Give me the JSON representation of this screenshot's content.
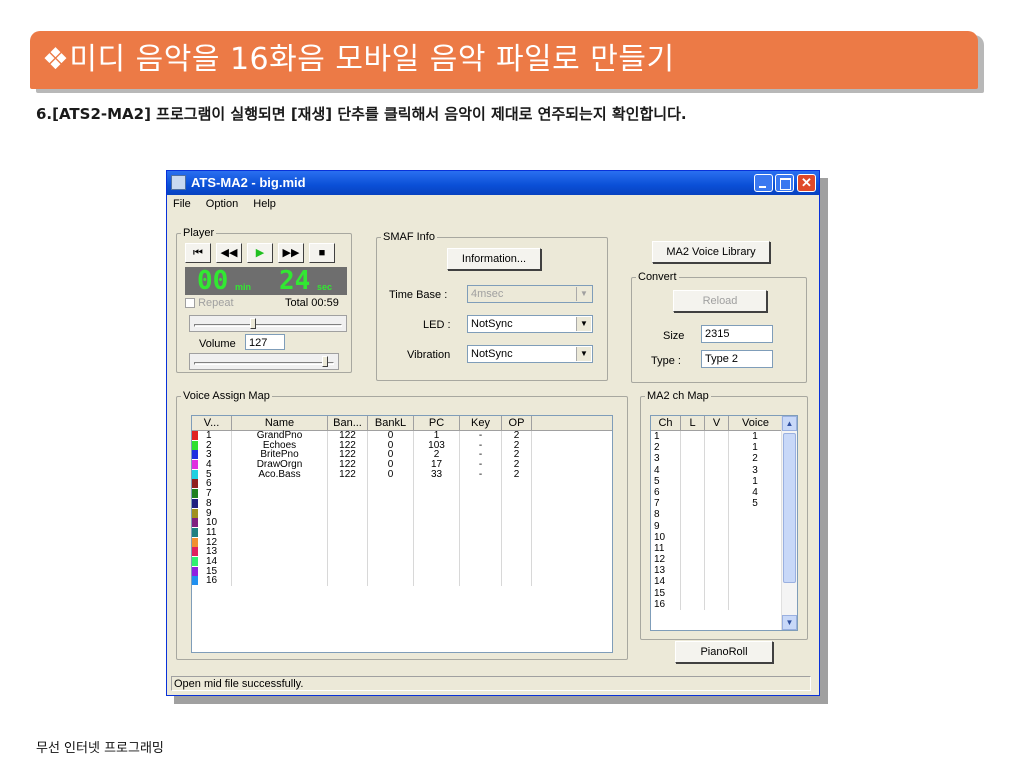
{
  "slide": {
    "title": "❖미디 음악을 16화음 모바일 음악 파일로 만들기",
    "subtitle": "6.[ATS2-MA2] 프로그램이 실행되면 [재생] 단추를 클릭해서 음악이 제대로 연주되는지 확인합니다.",
    "footer": "무선 인터넷 프로그래밍"
  },
  "window": {
    "title": "ATS-MA2 - big.mid",
    "close_glyph": "✕",
    "menu": [
      "File",
      "Option",
      "Help"
    ]
  },
  "player": {
    "legend": "Player",
    "controls": [
      "⏮",
      "◀◀",
      "▶",
      "▶▶",
      "■"
    ],
    "min_value": "00",
    "min_unit": "min",
    "sec_value": "24",
    "sec_unit": "sec",
    "repeat_label": "Repeat",
    "total": "Total 00:59",
    "volume_label": "Volume",
    "volume_value": "127",
    "position_fraction": 0.4,
    "volume_fraction": 0.97
  },
  "smaf": {
    "legend": "SMAF Info",
    "information_button": "Information...",
    "time_base_label": "Time Base :",
    "time_base_value": "4msec",
    "led_label": "LED :",
    "led_value": "NotSync",
    "vibration_label": "Vibration",
    "vibration_value": "NotSync"
  },
  "right_panel": {
    "voice_library_button": "MA2 Voice Library",
    "convert_legend": "Convert",
    "reload_button": "Reload",
    "size_label": "Size",
    "size_value": "2315",
    "type_label": "Type :",
    "type_value": "Type 2"
  },
  "voice_assign": {
    "legend": "Voice Assign Map",
    "columns": [
      "V...",
      "Name",
      "Ban...",
      "BankL",
      "PC",
      "Key",
      "OP"
    ],
    "rows": [
      {
        "v": "1",
        "color": "#e02020",
        "name": "GrandPno",
        "ban": "122",
        "bankl": "0",
        "pc": "1",
        "key": "-",
        "op": "2"
      },
      {
        "v": "2",
        "color": "#30e030",
        "name": "Echoes",
        "ban": "122",
        "bankl": "0",
        "pc": "103",
        "key": "-",
        "op": "2"
      },
      {
        "v": "3",
        "color": "#2030e0",
        "name": "BritePno",
        "ban": "122",
        "bankl": "0",
        "pc": "2",
        "key": "-",
        "op": "2"
      },
      {
        "v": "4",
        "color": "#e030e0",
        "name": "DrawOrgn",
        "ban": "122",
        "bankl": "0",
        "pc": "17",
        "key": "-",
        "op": "2"
      },
      {
        "v": "5",
        "color": "#20d0e0",
        "name": "Aco.Bass",
        "ban": "122",
        "bankl": "0",
        "pc": "33",
        "key": "-",
        "op": "2"
      },
      {
        "v": "6",
        "color": "#902020",
        "name": "",
        "ban": "",
        "bankl": "",
        "pc": "",
        "key": "",
        "op": ""
      },
      {
        "v": "7",
        "color": "#208020",
        "name": "",
        "ban": "",
        "bankl": "",
        "pc": "",
        "key": "",
        "op": ""
      },
      {
        "v": "8",
        "color": "#202080",
        "name": "",
        "ban": "",
        "bankl": "",
        "pc": "",
        "key": "",
        "op": ""
      },
      {
        "v": "9",
        "color": "#a09020",
        "name": "",
        "ban": "",
        "bankl": "",
        "pc": "",
        "key": "",
        "op": ""
      },
      {
        "v": "10",
        "color": "#802080",
        "name": "",
        "ban": "",
        "bankl": "",
        "pc": "",
        "key": "",
        "op": ""
      },
      {
        "v": "11",
        "color": "#208080",
        "name": "",
        "ban": "",
        "bankl": "",
        "pc": "",
        "key": "",
        "op": ""
      },
      {
        "v": "12",
        "color": "#f09030",
        "name": "",
        "ban": "",
        "bankl": "",
        "pc": "",
        "key": "",
        "op": ""
      },
      {
        "v": "13",
        "color": "#e02060",
        "name": "",
        "ban": "",
        "bankl": "",
        "pc": "",
        "key": "",
        "op": ""
      },
      {
        "v": "14",
        "color": "#30f070",
        "name": "",
        "ban": "",
        "bankl": "",
        "pc": "",
        "key": "",
        "op": ""
      },
      {
        "v": "15",
        "color": "#9020e0",
        "name": "",
        "ban": "",
        "bankl": "",
        "pc": "",
        "key": "",
        "op": ""
      },
      {
        "v": "16",
        "color": "#2090f0",
        "name": "",
        "ban": "",
        "bankl": "",
        "pc": "",
        "key": "",
        "op": ""
      }
    ]
  },
  "ch_map": {
    "legend": "MA2 ch Map",
    "columns": [
      "Ch",
      "L",
      "V",
      "Voice"
    ],
    "rows": [
      {
        "ch": "1",
        "voice": "1"
      },
      {
        "ch": "2",
        "voice": "1"
      },
      {
        "ch": "3",
        "voice": "2"
      },
      {
        "ch": "4",
        "voice": "3"
      },
      {
        "ch": "5",
        "voice": "1"
      },
      {
        "ch": "6",
        "voice": "4"
      },
      {
        "ch": "7",
        "voice": "5"
      },
      {
        "ch": "8",
        "voice": ""
      },
      {
        "ch": "9",
        "voice": ""
      },
      {
        "ch": "10",
        "voice": ""
      },
      {
        "ch": "11",
        "voice": ""
      },
      {
        "ch": "12",
        "voice": ""
      },
      {
        "ch": "13",
        "voice": ""
      },
      {
        "ch": "14",
        "voice": ""
      },
      {
        "ch": "15",
        "voice": ""
      },
      {
        "ch": "16",
        "voice": ""
      }
    ],
    "pianoroll_button": "PianoRoll"
  },
  "status": "Open mid file successfully."
}
